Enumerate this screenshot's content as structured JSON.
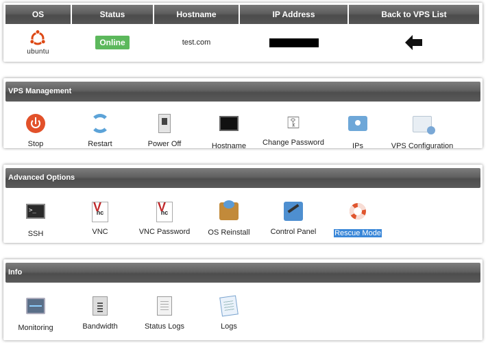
{
  "vps_table": {
    "headers": [
      "OS",
      "Status",
      "Hostname",
      "IP Address",
      "Back to VPS List"
    ],
    "os_label": "ubuntu",
    "status": "Online",
    "hostname": "test.com",
    "back_icon": "left-arrow-icon",
    "colors": {
      "status_online": "#5cb85c",
      "header_bg": "#5a5a5a"
    }
  },
  "sections": {
    "management": {
      "title": "VPS Management",
      "items": [
        {
          "label": "Stop",
          "icon": "power-icon"
        },
        {
          "label": "Restart",
          "icon": "restart-icon"
        },
        {
          "label": "Power Off",
          "icon": "switch-icon"
        },
        {
          "label": "Hostname",
          "icon": "monitor-icon"
        },
        {
          "label": "Change Password",
          "icon": "keys-icon"
        },
        {
          "label": "IPs",
          "icon": "network-icon"
        },
        {
          "label": "VPS Configuration",
          "icon": "config-icon"
        }
      ]
    },
    "advanced": {
      "title": "Advanced Options",
      "items": [
        {
          "label": "SSH",
          "icon": "terminal-icon"
        },
        {
          "label": "VNC",
          "icon": "vnc-icon"
        },
        {
          "label": "VNC Password",
          "icon": "vnc-keys-icon"
        },
        {
          "label": "OS Reinstall",
          "icon": "package-icon"
        },
        {
          "label": "Control Panel",
          "icon": "control-panel-icon"
        },
        {
          "label": "Rescue Mode",
          "icon": "lifebuoy-icon",
          "selected": true
        }
      ]
    },
    "info": {
      "title": "Info",
      "items": [
        {
          "label": "Monitoring",
          "icon": "monitor-graph-icon"
        },
        {
          "label": "Bandwidth",
          "icon": "bandwidth-icon"
        },
        {
          "label": "Status Logs",
          "icon": "status-logs-icon"
        },
        {
          "label": "Logs",
          "icon": "logs-icon"
        }
      ]
    }
  }
}
